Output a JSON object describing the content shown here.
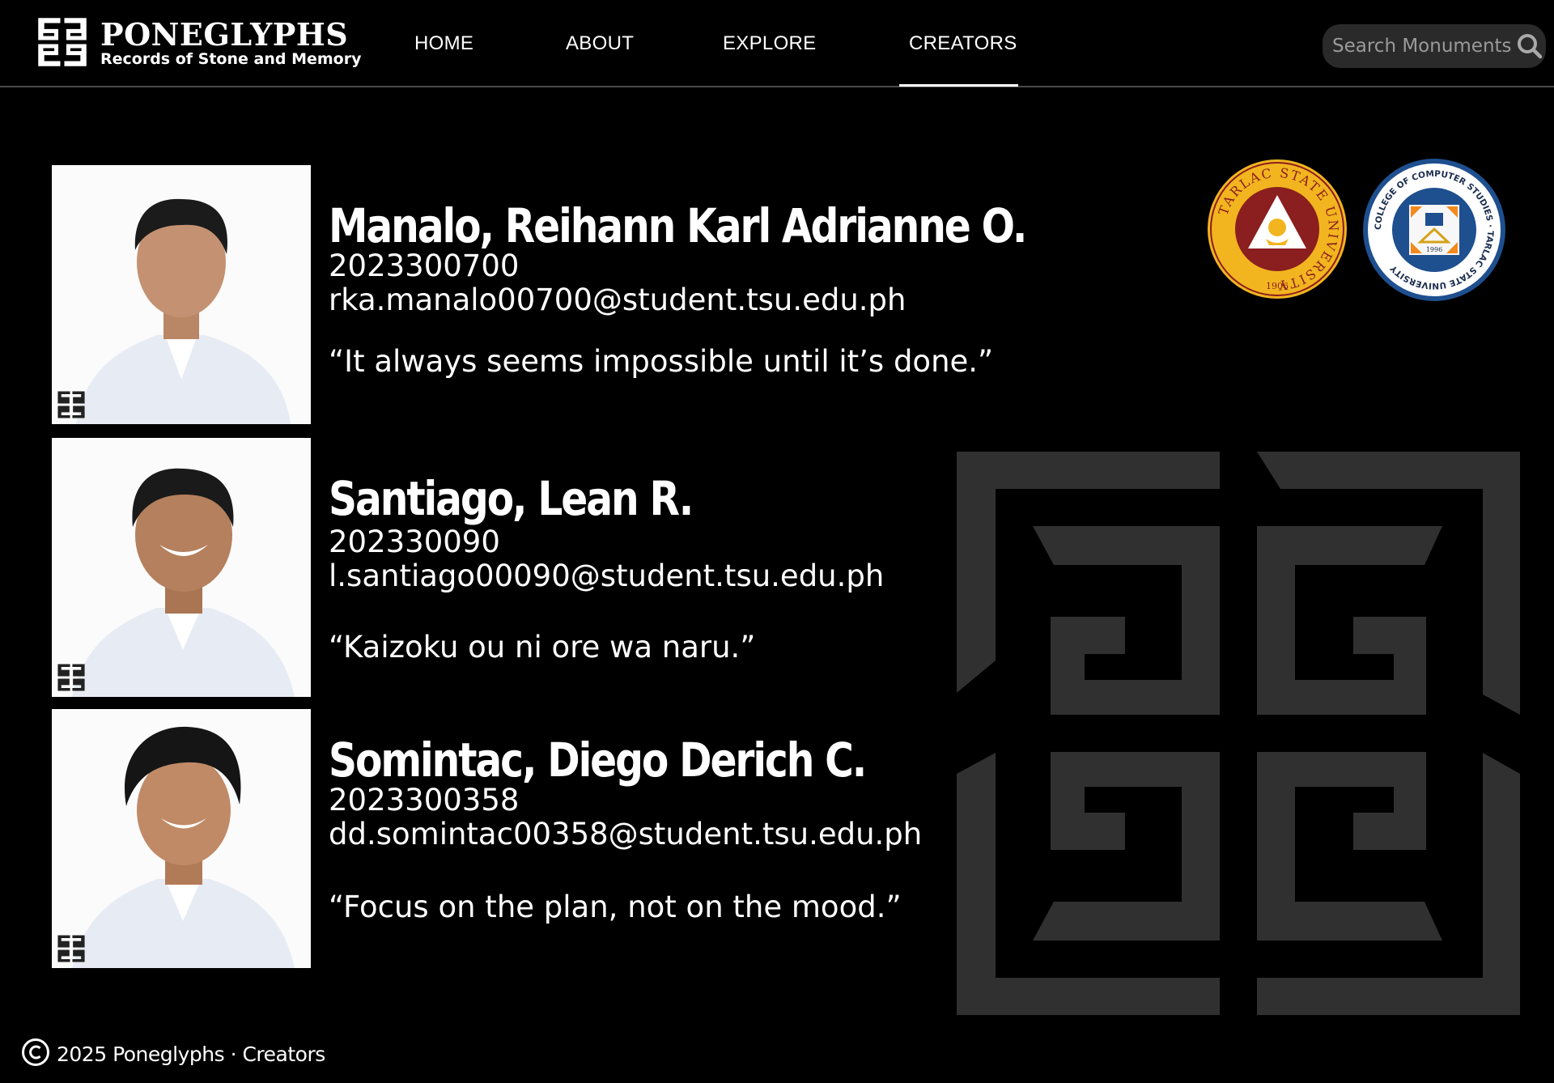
{
  "header": {
    "brand_name": "PONEGLYPHS",
    "brand_tagline": "Records of Stone and Memory",
    "nav": [
      "HOME",
      "ABOUT",
      "EXPLORE",
      "CREATORS"
    ],
    "active_nav": "CREATORS",
    "search_placeholder": "Search Monuments"
  },
  "creators": [
    {
      "name": "Manalo, Reihann Karl Adrianne O.",
      "student_id": "2023300700",
      "email": "rka.manalo00700@student.tsu.edu.ph",
      "quote": "“It always seems impossible until it’s done.”"
    },
    {
      "name": "Santiago, Lean R.",
      "student_id": "202330090",
      "email": "l.santiago00090@student.tsu.edu.ph",
      "quote": "“Kaizoku ou ni ore wa naru.”"
    },
    {
      "name": "Somintac, Diego Derich C.",
      "student_id": "2023300358",
      "email": "dd.somintac00358@student.tsu.edu.ph",
      "quote": "“Focus on the plan, not on the mood.”"
    }
  ],
  "seals": {
    "university": {
      "ring_text": "TARLAC STATE UNIVERSITY",
      "year": "1906"
    },
    "college": {
      "ring_text": "COLLEGE OF COMPUTER STUDIES · TARLAC STATE UNIVERSITY",
      "year": "1996"
    }
  },
  "footer": {
    "text": "2025 Poneglyphs · Creators"
  },
  "colors": {
    "background": "#000000",
    "text": "#ffffff",
    "search_bg": "#2a2a2a",
    "emblem": "#303030",
    "seal_gold": "#f2b51f",
    "seal_maroon": "#8b1e1e",
    "seal_blue": "#1e4f8f"
  },
  "icons": {
    "brand": "poneglyph-glyph-icon",
    "search": "search-icon",
    "copyright": "copyright-icon"
  }
}
